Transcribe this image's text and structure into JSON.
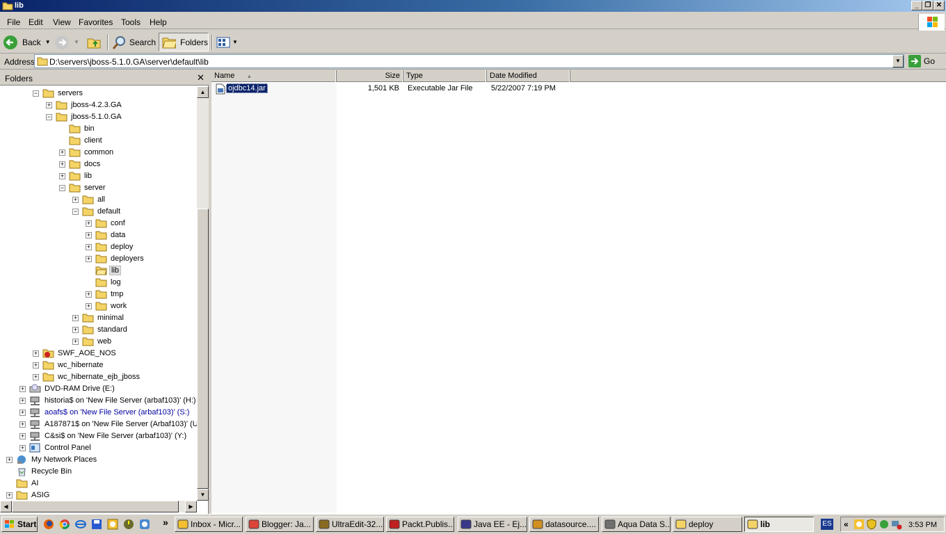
{
  "window": {
    "title": "lib",
    "min_label": "_",
    "max_label": "❐",
    "close_label": "✕"
  },
  "menu": [
    "File",
    "Edit",
    "View",
    "Favorites",
    "Tools",
    "Help"
  ],
  "toolbar": {
    "back_label": "Back",
    "search_label": "Search",
    "folders_label": "Folders"
  },
  "address": {
    "label": "Address",
    "value": "D:\\servers\\jboss-5.1.0.GA\\server\\default\\lib",
    "go_label": "Go"
  },
  "folders_pane": {
    "title": "Folders",
    "close_label": "✕",
    "tree": [
      {
        "label": "servers",
        "indent": 2,
        "expander": "−",
        "icon": "folder"
      },
      {
        "label": "jboss-4.2.3.GA",
        "indent": 3,
        "expander": "+",
        "icon": "folder"
      },
      {
        "label": "jboss-5.1.0.GA",
        "indent": 3,
        "expander": "−",
        "icon": "folder"
      },
      {
        "label": "bin",
        "indent": 4,
        "expander": "",
        "icon": "folder"
      },
      {
        "label": "client",
        "indent": 4,
        "expander": "",
        "icon": "folder"
      },
      {
        "label": "common",
        "indent": 4,
        "expander": "+",
        "icon": "folder"
      },
      {
        "label": "docs",
        "indent": 4,
        "expander": "+",
        "icon": "folder"
      },
      {
        "label": "lib",
        "indent": 4,
        "expander": "+",
        "icon": "folder"
      },
      {
        "label": "server",
        "indent": 4,
        "expander": "−",
        "icon": "folder"
      },
      {
        "label": "all",
        "indent": 5,
        "expander": "+",
        "icon": "folder"
      },
      {
        "label": "default",
        "indent": 5,
        "expander": "−",
        "icon": "folder"
      },
      {
        "label": "conf",
        "indent": 6,
        "expander": "+",
        "icon": "folder"
      },
      {
        "label": "data",
        "indent": 6,
        "expander": "+",
        "icon": "folder"
      },
      {
        "label": "deploy",
        "indent": 6,
        "expander": "+",
        "icon": "folder"
      },
      {
        "label": "deployers",
        "indent": 6,
        "expander": "+",
        "icon": "folder"
      },
      {
        "label": "lib",
        "indent": 6,
        "expander": "",
        "icon": "folder-open",
        "selected": true
      },
      {
        "label": "log",
        "indent": 6,
        "expander": "",
        "icon": "folder"
      },
      {
        "label": "tmp",
        "indent": 6,
        "expander": "+",
        "icon": "folder"
      },
      {
        "label": "work",
        "indent": 6,
        "expander": "+",
        "icon": "folder"
      },
      {
        "label": "minimal",
        "indent": 5,
        "expander": "+",
        "icon": "folder"
      },
      {
        "label": "standard",
        "indent": 5,
        "expander": "+",
        "icon": "folder"
      },
      {
        "label": "web",
        "indent": 5,
        "expander": "+",
        "icon": "folder"
      },
      {
        "label": "SWF_AOE_NOS",
        "indent": 2,
        "expander": "+",
        "icon": "folder-special"
      },
      {
        "label": "wc_hibernate",
        "indent": 2,
        "expander": "+",
        "icon": "folder"
      },
      {
        "label": "wc_hibernate_ejb_jboss",
        "indent": 2,
        "expander": "+",
        "icon": "folder"
      },
      {
        "label": "DVD-RAM Drive (E:)",
        "indent": 1,
        "expander": "+",
        "icon": "dvd-drive"
      },
      {
        "label": "historia$ on 'New File Server (arbaf103)' (H:)",
        "indent": 1,
        "expander": "+",
        "icon": "network-drive"
      },
      {
        "label": "aoafs$ on 'New File Server (arbaf103)' (S:)",
        "indent": 1,
        "expander": "+",
        "icon": "network-drive",
        "link": true
      },
      {
        "label": "A187871$ on 'New File Server (Arbaf103)' (U:",
        "indent": 1,
        "expander": "+",
        "icon": "network-drive"
      },
      {
        "label": "C&si$ on 'New File Server (arbaf103)' (Y:)",
        "indent": 1,
        "expander": "+",
        "icon": "network-drive"
      },
      {
        "label": "Control Panel",
        "indent": 1,
        "expander": "+",
        "icon": "control-panel"
      },
      {
        "label": "My Network Places",
        "indent": 0,
        "expander": "+",
        "icon": "network-places"
      },
      {
        "label": "Recycle Bin",
        "indent": 0,
        "expander": "",
        "icon": "recycle-bin"
      },
      {
        "label": "AI",
        "indent": 0,
        "expander": "",
        "icon": "folder"
      },
      {
        "label": "ASIG",
        "indent": 0,
        "expander": "+",
        "icon": "folder"
      }
    ]
  },
  "list": {
    "columns": [
      "Name",
      "Size",
      "Type",
      "Date Modified"
    ],
    "files": [
      {
        "name": "ojdbc14.jar",
        "size": "1,501 KB",
        "type": "Executable Jar File",
        "modified": "5/22/2007 7:19 PM"
      }
    ]
  },
  "taskbar": {
    "start_label": "Start",
    "tasks": [
      {
        "label": "Inbox - Micr...",
        "icon": "outlook-icon"
      },
      {
        "label": "Blogger: Ja...",
        "icon": "chrome-icon"
      },
      {
        "label": "UltraEdit-32...",
        "icon": "ultraedit-icon"
      },
      {
        "label": "Packt.Publis...",
        "icon": "pdf-icon"
      },
      {
        "label": "Java EE - Ej...",
        "icon": "eclipse-icon"
      },
      {
        "label": "datasource....",
        "icon": "notepad-icon"
      },
      {
        "label": "Aqua Data S...",
        "icon": "database-icon"
      },
      {
        "label": "deploy",
        "icon": "folder-icon"
      },
      {
        "label": "lib",
        "icon": "folder-icon",
        "active": true
      }
    ],
    "lang": "ES",
    "more_label": "»",
    "tray_collapse": "«",
    "clock": "3:53 PM"
  },
  "colors": {
    "title_start": "#0a246a",
    "title_end": "#a6caf0",
    "selection": "#0a246a",
    "folder": "#f4d466"
  }
}
